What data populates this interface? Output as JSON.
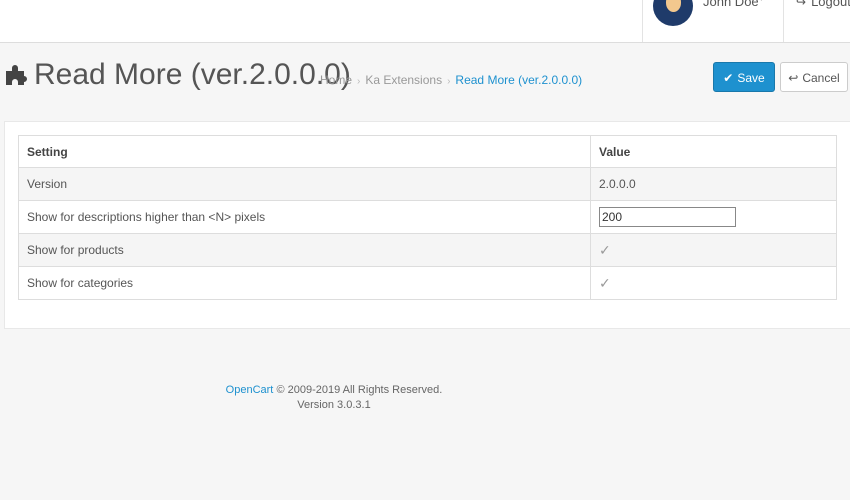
{
  "header": {
    "user_name": "John Doe",
    "user_caret": "▾",
    "logout_label": "Logout"
  },
  "page": {
    "title": "Read More (ver.2.0.0.0)",
    "breadcrumb": [
      "Home",
      "Ka Extensions",
      "Read More (ver.2.0.0.0)"
    ],
    "save_label": "Save",
    "cancel_label": "Cancel"
  },
  "table": {
    "headers": [
      "Setting",
      "Value"
    ],
    "rows": [
      {
        "setting": "Version",
        "value": "2.0.0.0"
      },
      {
        "setting": "Show for descriptions higher than <N> pixels",
        "value": "200"
      },
      {
        "setting": "Show for products",
        "value": "✓"
      },
      {
        "setting": "Show for categories",
        "value": "✓"
      }
    ]
  },
  "footer": {
    "link": "OpenCart",
    "copyright": "© 2009-2019 All Rights Reserved.",
    "version": "Version 3.0.3.1"
  },
  "colors": {
    "accent": "#1e91cf",
    "save_border": "#1978ab",
    "background": "#f6f6f6"
  },
  "icons": {
    "title": "puzzle-icon",
    "save": "check-circle-icon",
    "cancel": "reply-icon",
    "logout": "sign-out-icon",
    "checkbox": "checkmark-icon"
  }
}
